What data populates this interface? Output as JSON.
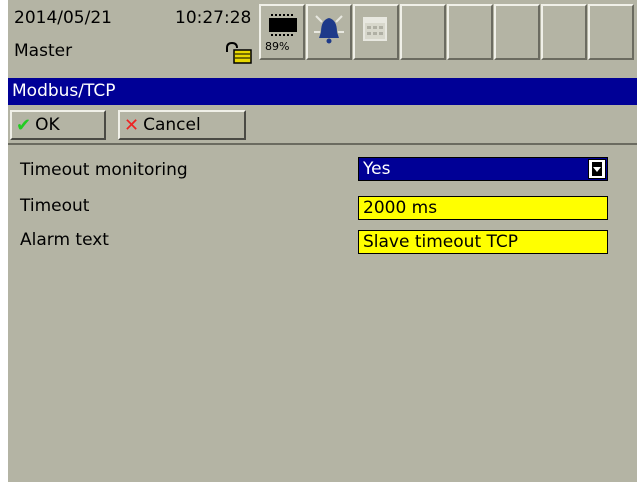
{
  "status": {
    "date": "2014/05/21",
    "time": "10:27:28",
    "user": "Master",
    "memory_percent": "89%",
    "icons": [
      "lock-icon",
      "memory-icon",
      "alarm-bell-icon",
      "calendar-icon"
    ]
  },
  "title": "Modbus/TCP",
  "toolbar": {
    "ok_label": "OK",
    "cancel_label": "Cancel"
  },
  "form": {
    "rows": [
      {
        "label": "Timeout monitoring",
        "value": "Yes"
      },
      {
        "label": "Timeout",
        "value": "2000 ms"
      },
      {
        "label": "Alarm text",
        "value": "Slave timeout TCP"
      }
    ]
  },
  "colors": {
    "title_bar": "#000096",
    "background": "#b4b4a4",
    "input_highlight": "#ffff00",
    "ok_check": "#22cc22",
    "cancel_x": "#ee2222"
  }
}
